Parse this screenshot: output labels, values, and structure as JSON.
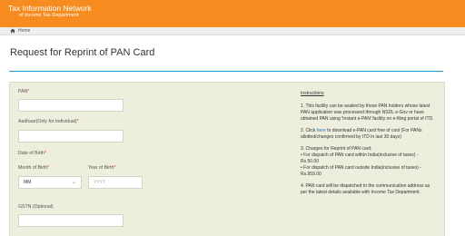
{
  "header": {
    "title": "Tax Information Network",
    "subtitle": "of Income Tax Department",
    "color": "#f68b1f"
  },
  "breadcrumb": {
    "icon": "home-icon",
    "label": "Home"
  },
  "page": {
    "title": "Request for Reprint of PAN Card"
  },
  "form": {
    "pan": {
      "label": "PAN",
      "required_mark": "*",
      "value": ""
    },
    "aadhaar": {
      "label": "Aadhaar(Only for Individual)",
      "required_mark": "*",
      "value": ""
    },
    "dob": {
      "label": "Date of Birth",
      "required_mark": "*",
      "month": {
        "label": "Month of Birth",
        "required_mark": "*",
        "selected": "MM"
      },
      "year": {
        "label": "Year of Birth",
        "required_mark": "*",
        "placeholder": "YYYY"
      }
    },
    "gstn": {
      "label": "GSTN (Optional)",
      "value": ""
    }
  },
  "instructions": {
    "title": "Instructions",
    "item1": "1. This facility can be availed by those PAN holders whose latest PAN application was processed through NSDL e-Gov or have obtained PAN using 'Instant e-PAN' facility on e-filing portal of ITD.",
    "item2_prefix": "2. Click ",
    "item2_link": "here",
    "item2_suffix": " to download e-PAN card free of cost (For PANs allotted/changes confirmed by ITD in last 30 days)",
    "item3_title": "3. Charges for Reprint of PAN card:",
    "item3_a": "• For dispatch of PAN card within India(inclusive of taxes) - Rs.50.00",
    "item3_b": "• For dispatch of PAN card outside India(inclusive of taxes) - Rs.959.00",
    "item4": "4. PAN card will be dispatched to the communication address as per the latest details available with Income Tax Department."
  }
}
